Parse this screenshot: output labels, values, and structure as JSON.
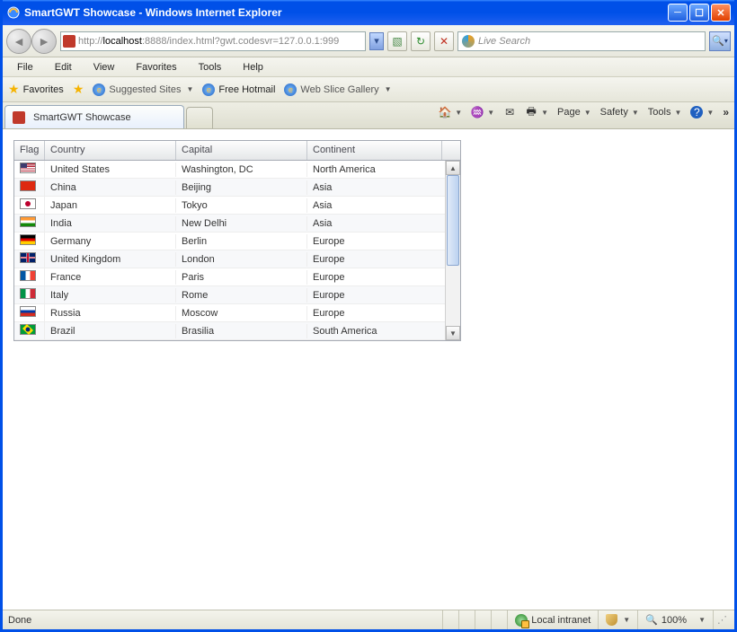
{
  "window": {
    "title": "SmartGWT Showcase - Windows Internet Explorer"
  },
  "address": {
    "prefix": "http://",
    "host": "localhost",
    "rest": ":8888/index.html?gwt.codesvr=127.0.0.1:999"
  },
  "search": {
    "placeholder": "Live Search"
  },
  "menubar": [
    "File",
    "Edit",
    "View",
    "Favorites",
    "Tools",
    "Help"
  ],
  "favbar": {
    "favorites": "Favorites",
    "suggested": "Suggested Sites",
    "hotmail": "Free Hotmail",
    "webslice": "Web Slice Gallery"
  },
  "tab": {
    "label": "SmartGWT Showcase"
  },
  "commandbar": {
    "page": "Page",
    "safety": "Safety",
    "tools": "Tools"
  },
  "grid": {
    "headers": {
      "flag": "Flag",
      "country": "Country",
      "capital": "Capital",
      "continent": "Continent"
    },
    "rows": [
      {
        "flag": "us",
        "country": "United States",
        "capital": "Washington, DC",
        "continent": "North America"
      },
      {
        "flag": "cn",
        "country": "China",
        "capital": "Beijing",
        "continent": "Asia"
      },
      {
        "flag": "jp",
        "country": "Japan",
        "capital": "Tokyo",
        "continent": "Asia"
      },
      {
        "flag": "in",
        "country": "India",
        "capital": "New Delhi",
        "continent": "Asia"
      },
      {
        "flag": "de",
        "country": "Germany",
        "capital": "Berlin",
        "continent": "Europe"
      },
      {
        "flag": "gb",
        "country": "United Kingdom",
        "capital": "London",
        "continent": "Europe"
      },
      {
        "flag": "fr",
        "country": "France",
        "capital": "Paris",
        "continent": "Europe"
      },
      {
        "flag": "it",
        "country": "Italy",
        "capital": "Rome",
        "continent": "Europe"
      },
      {
        "flag": "ru",
        "country": "Russia",
        "capital": "Moscow",
        "continent": "Europe"
      },
      {
        "flag": "br",
        "country": "Brazil",
        "capital": "Brasilia",
        "continent": "South America"
      }
    ]
  },
  "statusbar": {
    "status": "Done",
    "zone": "Local intranet",
    "zoom": "100%"
  }
}
